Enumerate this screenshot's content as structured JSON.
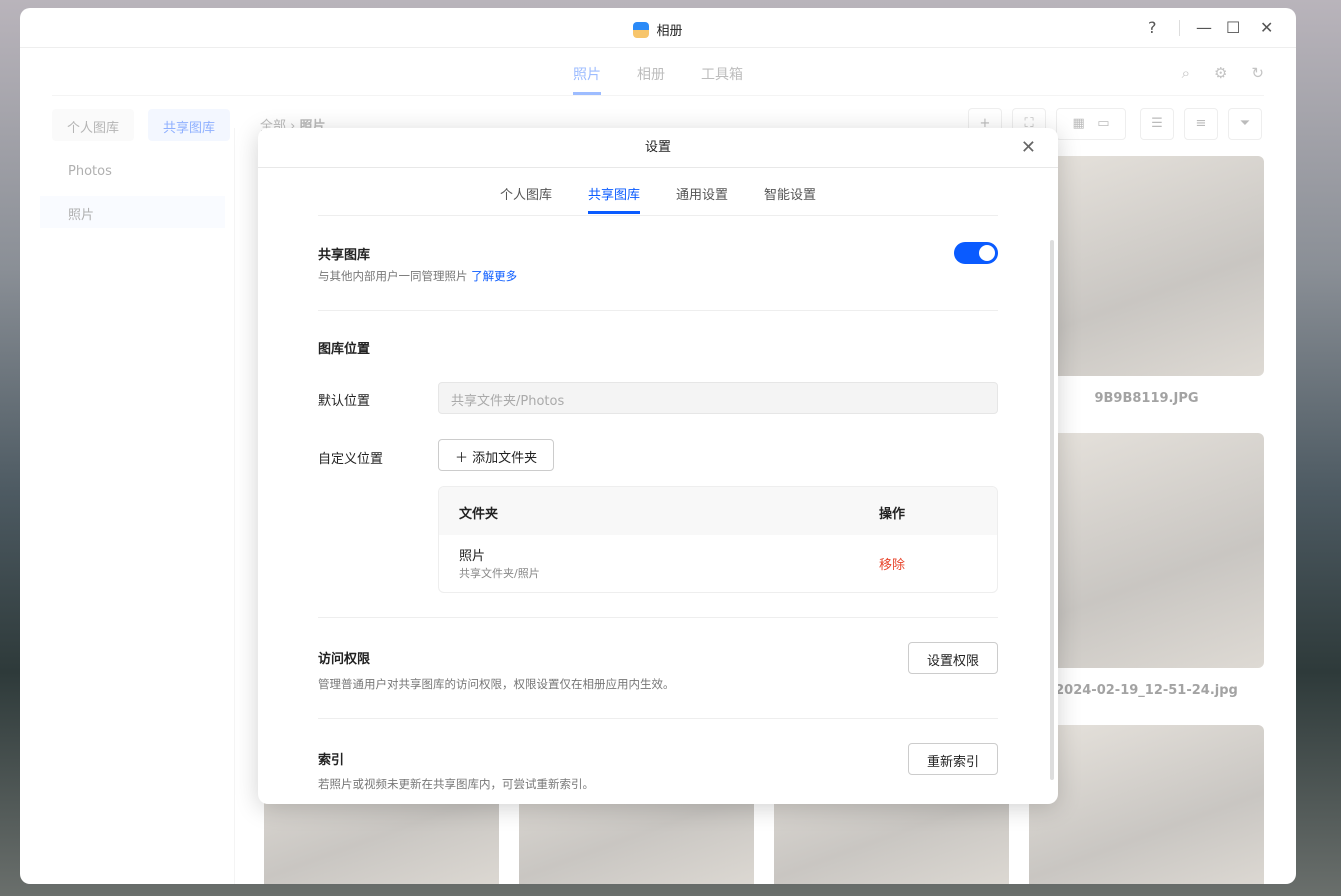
{
  "window": {
    "title": "相册",
    "controls": [
      "?",
      "—",
      "☐",
      "✕"
    ]
  },
  "nav": {
    "tabs": [
      "照片",
      "相册",
      "工具箱"
    ],
    "icons": [
      "search-icon",
      "gear-icon",
      "refresh-icon"
    ]
  },
  "library": {
    "personal": "个人图库",
    "shared": "共享图库"
  },
  "breadcrumb": {
    "root": "全部",
    "sep": "›",
    "current": "照片"
  },
  "sidebar": {
    "items": [
      "Photos",
      "照片"
    ]
  },
  "photos": [
    {
      "caption": "9B9B8119.JPG"
    },
    {
      "caption": "2024-02-19_12-51-24.jpg"
    }
  ],
  "modal": {
    "title": "设置",
    "tabs": [
      "个人图库",
      "共享图库",
      "通用设置",
      "智能设置"
    ],
    "shared": {
      "title": "共享图库",
      "desc": "与其他内部用户一同管理照片",
      "link": "了解更多",
      "enabled": true
    },
    "location": {
      "title": "图库位置",
      "default_label": "默认位置",
      "default_placeholder": "共享文件夹/Photos",
      "custom_label": "自定义位置",
      "add_button": "添加文件夹",
      "table": {
        "headers": [
          "文件夹",
          "操作"
        ],
        "rows": [
          {
            "name": "照片",
            "path": "共享文件夹/照片",
            "action": "移除"
          }
        ]
      }
    },
    "access": {
      "title": "访问权限",
      "desc": "管理普通用户对共享图库的访问权限，权限设置仅在相册应用内生效。",
      "button": "设置权限"
    },
    "index": {
      "title": "索引",
      "desc": "若照片或视频未更新在共享图库内，可尝试重新索引。",
      "button": "重新索引"
    }
  }
}
